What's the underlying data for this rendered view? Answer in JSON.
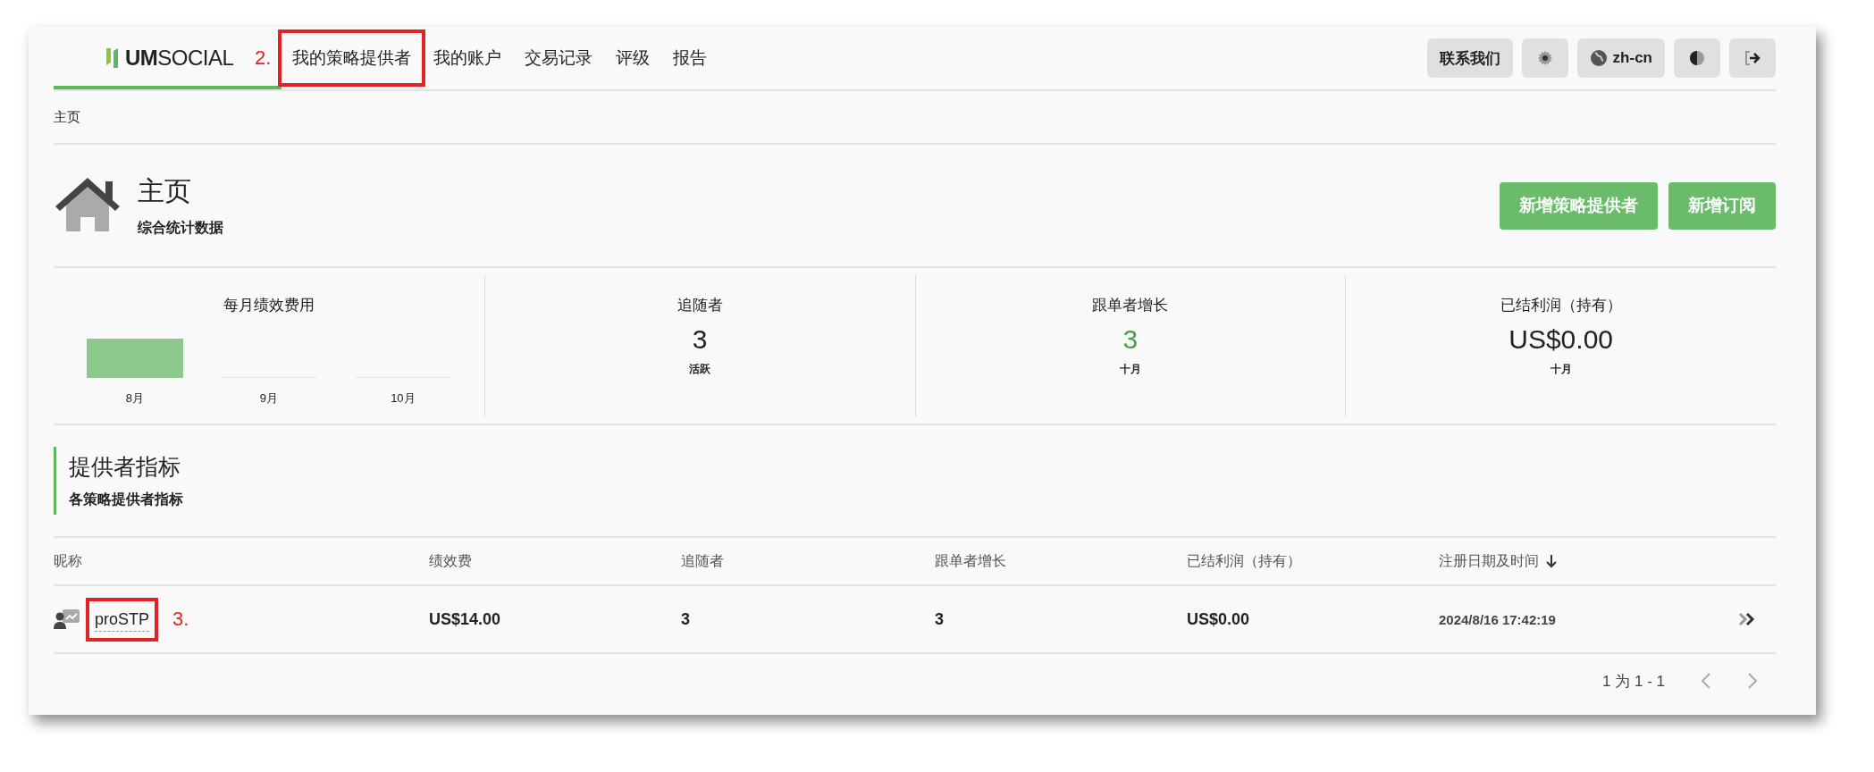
{
  "nav": {
    "logo": {
      "text": "**UM**SOCIAL",
      "active": true
    },
    "items": [
      {
        "label": "我的策略提供者",
        "highlighted": true
      },
      {
        "label": "我的账户",
        "highlighted": false
      },
      {
        "label": "交易记录",
        "highlighted": false
      },
      {
        "label": "评级",
        "highlighted": false
      },
      {
        "label": "报告",
        "highlighted": false
      }
    ],
    "actions": [
      {
        "kind": "text",
        "label": "联系我们"
      },
      {
        "kind": "settings"
      },
      {
        "kind": "language",
        "label": "zh-cn"
      },
      {
        "kind": "theme"
      },
      {
        "kind": "logout"
      }
    ]
  },
  "breadcrumb": "主页",
  "header": {
    "title": "主页",
    "subtitle": "综合统计数据",
    "buttons": [
      "新增策略提供者",
      "新增订阅"
    ]
  },
  "stats": [
    {
      "kind": "chart",
      "title": "每月绩效费用",
      "months": [
        {
          "label": "8月",
          "has_fee": true
        },
        {
          "label": "9月",
          "has_fee": false
        },
        {
          "label": "10月",
          "has_fee": false
        }
      ]
    },
    {
      "kind": "number",
      "title": "追随者",
      "value": "3",
      "note": "活跃",
      "positive": false
    },
    {
      "kind": "number",
      "title": "跟单者增长",
      "value": "3",
      "note": "十月",
      "positive": true
    },
    {
      "kind": "number",
      "title": "已结利润（持有）",
      "value": "US$0.00",
      "note": "十月",
      "positive": false
    }
  ],
  "section": {
    "title": "提供者指标",
    "subtitle": "各策略提供者指标"
  },
  "table": {
    "columns": [
      {
        "label": "昵称",
        "sorted": false
      },
      {
        "label": "绩效费",
        "sorted": false
      },
      {
        "label": "追随者",
        "sorted": false
      },
      {
        "label": "跟单者增长",
        "sorted": false
      },
      {
        "label": "已结利润（持有）",
        "sorted": false
      },
      {
        "label": "注册日期及时间",
        "sorted": true
      }
    ],
    "rows": [
      {
        "name": "proSTP",
        "highlighted": true,
        "fee": "US$14.00",
        "followers": "3",
        "growth": "3",
        "profit": "US$0.00",
        "registered": "2024/8/16 17:42:19"
      }
    ]
  },
  "pagination": {
    "text": "1 为 1 - 1"
  },
  "annotations": {
    "nav_callout": "2.",
    "row_callout": "3."
  }
}
